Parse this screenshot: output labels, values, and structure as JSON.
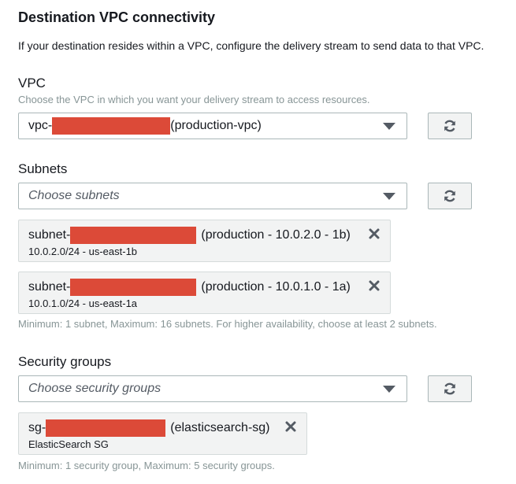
{
  "section": {
    "title": "Destination VPC connectivity",
    "description": "If your destination resides within a VPC, configure the delivery stream to send data to that VPC."
  },
  "vpc": {
    "label": "VPC",
    "hint": "Choose the VPC in which you want your delivery stream to access resources.",
    "selected_prefix": "vpc-",
    "selected_suffix": "(production-vpc)",
    "dropdown_icon": "caret-down-icon",
    "refresh_icon": "refresh-icon"
  },
  "subnets": {
    "label": "Subnets",
    "placeholder": "Choose subnets",
    "items": [
      {
        "prefix": "subnet-",
        "suffix": "(production - 10.0.2.0 - 1b)",
        "detail": "10.0.2.0/24 - us-east-1b"
      },
      {
        "prefix": "subnet-",
        "suffix": "(production - 10.0.1.0 - 1a)",
        "detail": "10.0.1.0/24 - us-east-1a"
      }
    ],
    "constraint": "Minimum: 1 subnet, Maximum: 16 subnets. For higher availability, choose at least 2 subnets."
  },
  "security_groups": {
    "label": "Security groups",
    "placeholder": "Choose security groups",
    "items": [
      {
        "prefix": "sg-",
        "suffix": "(elasticsearch-sg)",
        "detail": "ElasticSearch SG"
      }
    ],
    "constraint": "Minimum: 1 security group, Maximum: 5 security groups."
  },
  "colors": {
    "redaction": "#dc4a38",
    "border": "#aab7b8",
    "hint_text": "#879596",
    "token_bg": "#f2f3f3"
  }
}
